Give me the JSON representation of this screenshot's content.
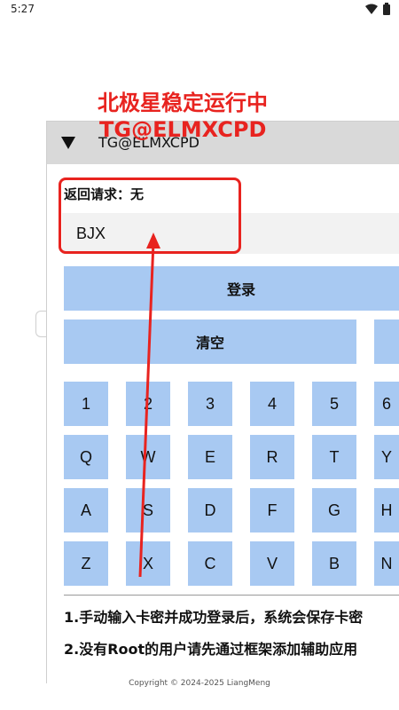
{
  "status_bar": {
    "time": "5:27",
    "icons": [
      "wifi-icon",
      "battery-icon"
    ]
  },
  "overlay": {
    "title": "北极星稳定运行中",
    "subtitle": "TG@ELMXCPD"
  },
  "panel": {
    "title": "TG@ELMXCPD",
    "response_label": "返回请求：无",
    "input_value": "BJX",
    "login_label": "登录",
    "clear_label": "清空"
  },
  "keypad": {
    "rows": [
      [
        "1",
        "2",
        "3",
        "4",
        "5",
        "6"
      ],
      [
        "Q",
        "W",
        "E",
        "R",
        "T",
        "Y"
      ],
      [
        "A",
        "S",
        "D",
        "F",
        "G",
        "H"
      ],
      [
        "Z",
        "X",
        "C",
        "V",
        "B",
        "N"
      ]
    ]
  },
  "notes": [
    "1.手动输入卡密并成功登录后，系统会保存卡密",
    "2.没有Root的用户请先通过框架添加辅助应用"
  ],
  "footer": "Copyright © 2024-2025 LiangMeng",
  "colors": {
    "accent": "#e8231f",
    "button": "#a8c9f2",
    "header": "#d9d9d9"
  }
}
